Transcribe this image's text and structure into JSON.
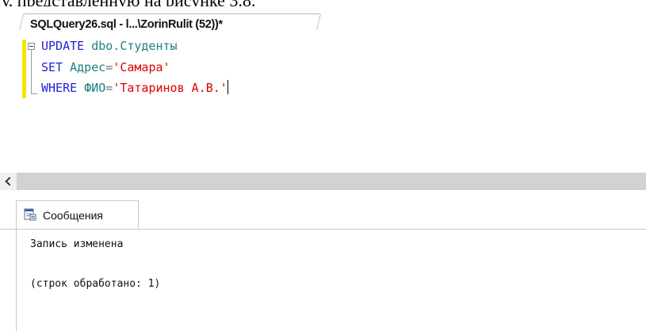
{
  "page_top_text": "у, представленную на рисунке 3.8.",
  "query_tab": {
    "title": "SQLQuery26.sql - l...\\ZorinRulit (52))*"
  },
  "editor": {
    "line1": {
      "kw": "UPDATE",
      "obj": "dbo.Студенты"
    },
    "line2": {
      "kw": "SET",
      "col": "Адрес",
      "op": "=",
      "str": "'Самара'"
    },
    "line3": {
      "kw": "WHERE",
      "col": "ФИО",
      "op": "=",
      "str": "'Татаринов А.В.'"
    }
  },
  "results_tab": {
    "label": "Сообщения"
  },
  "messages": {
    "line1": "Запись изменена",
    "line2": "(строк обработано: 1)"
  },
  "colors": {
    "keyword": "#1f1fdd",
    "object": "#1a8080",
    "string": "#e00000",
    "change_marker": "#f5e400"
  }
}
